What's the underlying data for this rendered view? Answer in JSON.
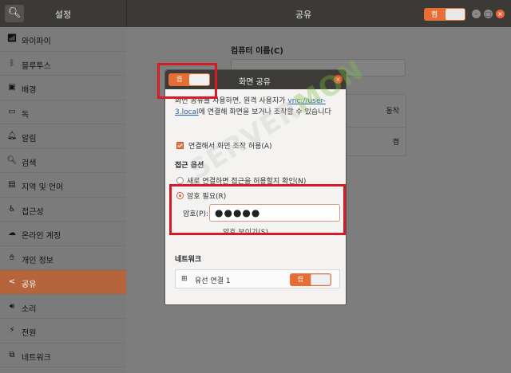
{
  "titlebar": {
    "settings_title": "설정",
    "page_title": "공유",
    "toggle_label": "켬"
  },
  "sidebar": {
    "items": [
      {
        "label": "와이파이",
        "icon": "wifi-icon"
      },
      {
        "label": "블루투스",
        "icon": "bluetooth-icon"
      },
      {
        "label": "배경",
        "icon": "background-icon"
      },
      {
        "label": "독",
        "icon": "dock-icon"
      },
      {
        "label": "알림",
        "icon": "bell-icon"
      },
      {
        "label": "검색",
        "icon": "search-icon"
      },
      {
        "label": "지역 및 언어",
        "icon": "region-icon"
      },
      {
        "label": "접근성",
        "icon": "accessibility-icon"
      },
      {
        "label": "온라인 계정",
        "icon": "online-accounts-icon"
      },
      {
        "label": "개인 정보",
        "icon": "privacy-icon"
      },
      {
        "label": "공유",
        "icon": "share-icon",
        "active": true
      },
      {
        "label": "소리",
        "icon": "sound-icon"
      },
      {
        "label": "전원",
        "icon": "power-icon"
      },
      {
        "label": "네트워크",
        "icon": "network-icon"
      }
    ]
  },
  "main": {
    "computer_name_label": "컴퓨터 이름(C)",
    "services": {
      "screen_sharing_status": "동작",
      "media_sharing_status": "켬"
    }
  },
  "dialog": {
    "toggle_label": "켬",
    "title": "화면 공유",
    "intro_before": "화면 공유를 사용하면, 원격 사용자가",
    "intro_link": "vnc://user-3.local",
    "intro_after": "에 연결해 화면을 보거나 조작할 수 있습니다",
    "allow_control_label": "연결해서 화면 조작 허용(A)",
    "access_options_heading": "접근 옵션",
    "new_connection_label": "새로 연결하면 접근을 허용할지 확인(N)",
    "require_password_label": "암호 필요(R)",
    "password_label": "암호(P):",
    "password_value": "●●●●●",
    "show_password_label": "암호 보이기(S)",
    "network_heading": "네트워크",
    "network_name": "유선 연결 1",
    "network_toggle_label": "켬"
  },
  "watermark": {
    "part1": "SERVER",
    "part2": "MON"
  },
  "colors": {
    "accent": "#e66e35",
    "highlight": "#d71b26",
    "link": "#2a60a8"
  }
}
